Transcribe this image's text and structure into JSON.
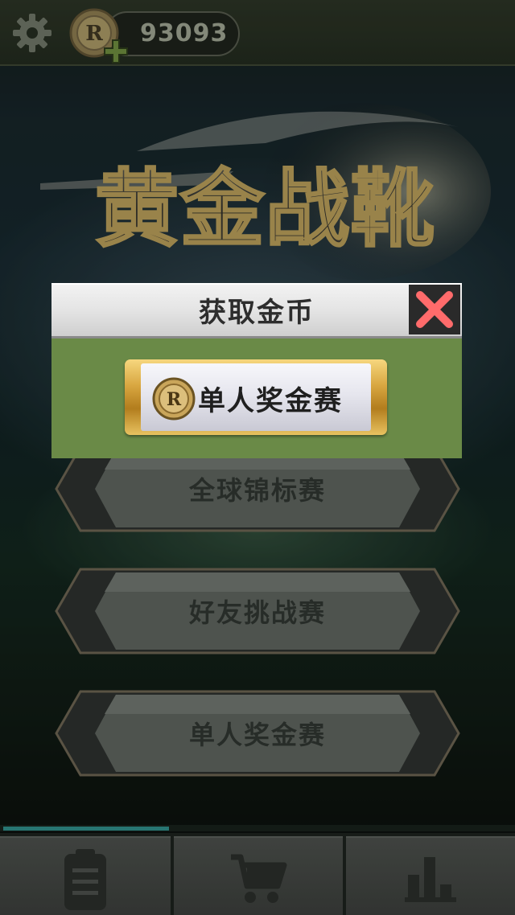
{
  "topbar": {
    "coins": "93093",
    "settings_icon": "gear-icon",
    "coin_icon": "coin-r-icon",
    "add_icon": "plus-icon"
  },
  "logo": {
    "text": "黄金战靴"
  },
  "menu": {
    "buttons": [
      {
        "label": "全球锦标赛"
      },
      {
        "label": "好友挑战赛"
      },
      {
        "label": "单人奖金赛"
      }
    ]
  },
  "modal": {
    "title": "获取金币",
    "option_label": "单人奖金赛",
    "close_icon": "close-x-icon"
  },
  "bottom_nav": {
    "tabs": [
      {
        "icon": "clipboard-icon"
      },
      {
        "icon": "cart-icon"
      },
      {
        "icon": "bar-chart-icon"
      }
    ]
  },
  "colors": {
    "modal_body": "#6a8a47",
    "close_x": "#ff6b6b",
    "progress": "#2e8a86"
  }
}
